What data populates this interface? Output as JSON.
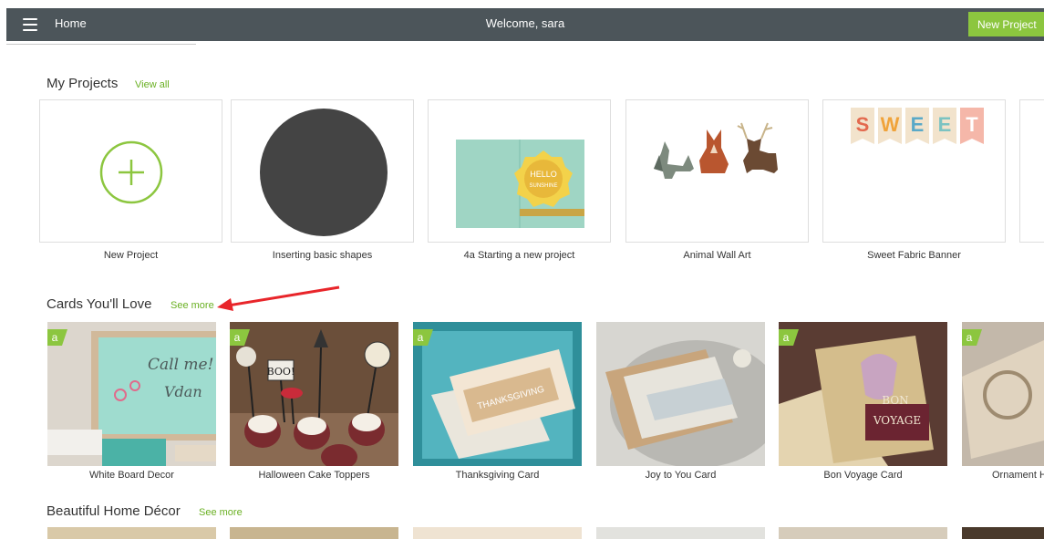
{
  "topbar": {
    "menu_icon": "hamburger-menu-icon",
    "home_label": "Home",
    "welcome_text": "Welcome, sara",
    "new_project_button": "New Project"
  },
  "my_projects": {
    "title": "My Projects",
    "view_all": "View all",
    "items": [
      {
        "label": "New Project",
        "icon": "plus-circle-icon"
      },
      {
        "label": "Inserting basic shapes"
      },
      {
        "label": "4a Starting a new project",
        "image_text": [
          "HELLO",
          "SUNSHINE"
        ]
      },
      {
        "label": "Animal Wall Art"
      },
      {
        "label": "Sweet Fabric Banner",
        "banner_letters": [
          "S",
          "W",
          "E",
          "E",
          "T"
        ]
      }
    ]
  },
  "cards": {
    "title": "Cards You'll Love",
    "see_more": "See more",
    "badge_letter": "a",
    "items": [
      {
        "label": "White Board Decor",
        "image_text": "Call me! Vdan"
      },
      {
        "label": "Halloween Cake Toppers",
        "image_text": "BOO!"
      },
      {
        "label": "Thanksgiving Card",
        "image_text": "THANKSGIVING"
      },
      {
        "label": "Joy to You Card"
      },
      {
        "label": "Bon Voyage Card",
        "image_text": [
          "BON",
          "VOYAGE"
        ]
      },
      {
        "label": "Ornament H"
      }
    ]
  },
  "home_decor": {
    "title": "Beautiful Home Décor",
    "see_more": "See more"
  },
  "colors": {
    "topbar": "#4c555a",
    "accent_green": "#8cc63f",
    "link_green": "#6ab023",
    "annotation_arrow": "#e8252a"
  }
}
